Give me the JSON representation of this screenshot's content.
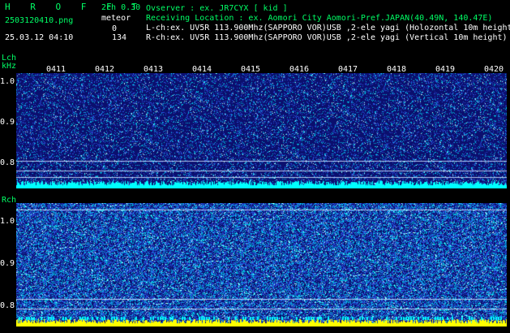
{
  "header": {
    "brand": "H R O F F T",
    "version": "2ch 0.30",
    "filename": "2503120410.png",
    "meteor_label": "meteor",
    "datetime": "25.03.12 04:10",
    "count_l": "0",
    "count_r": "134",
    "observer": "Ovserver            : ex. JR7CYX [ kid ]",
    "location": "Receiving Location : ex. Aomori City Aomori-Pref.JAPAN(40.49N, 140.47E)",
    "lch_info": "L-ch:ex. UV5R 113.900Mhz(SAPPORO VOR)USB ,2-ele yagi (Holozontal 10m height)",
    "rch_info": "R-ch:ex. UV5R 113.900Mhz(SAPPORO VOR)USB ,2-ele yagi (Vertical 10m height)"
  },
  "lch": {
    "label": "Lch",
    "unit": "kHz",
    "y_ticks": [
      "1.0",
      "0.9",
      "0.8"
    ]
  },
  "rch": {
    "label": "Rch",
    "y_ticks": [
      "1.0",
      "0.9",
      "0.8"
    ]
  },
  "time_labels": [
    "0411",
    "0412",
    "0413",
    "0414",
    "0415",
    "0416",
    "0417",
    "0418",
    "0419",
    "0420"
  ],
  "colors": {
    "background": "#000000",
    "spectrum_low": "#0b0f6e",
    "spectrum_high": "#00ffff",
    "signal": "#ffff00",
    "brand": "#00ff66"
  }
}
